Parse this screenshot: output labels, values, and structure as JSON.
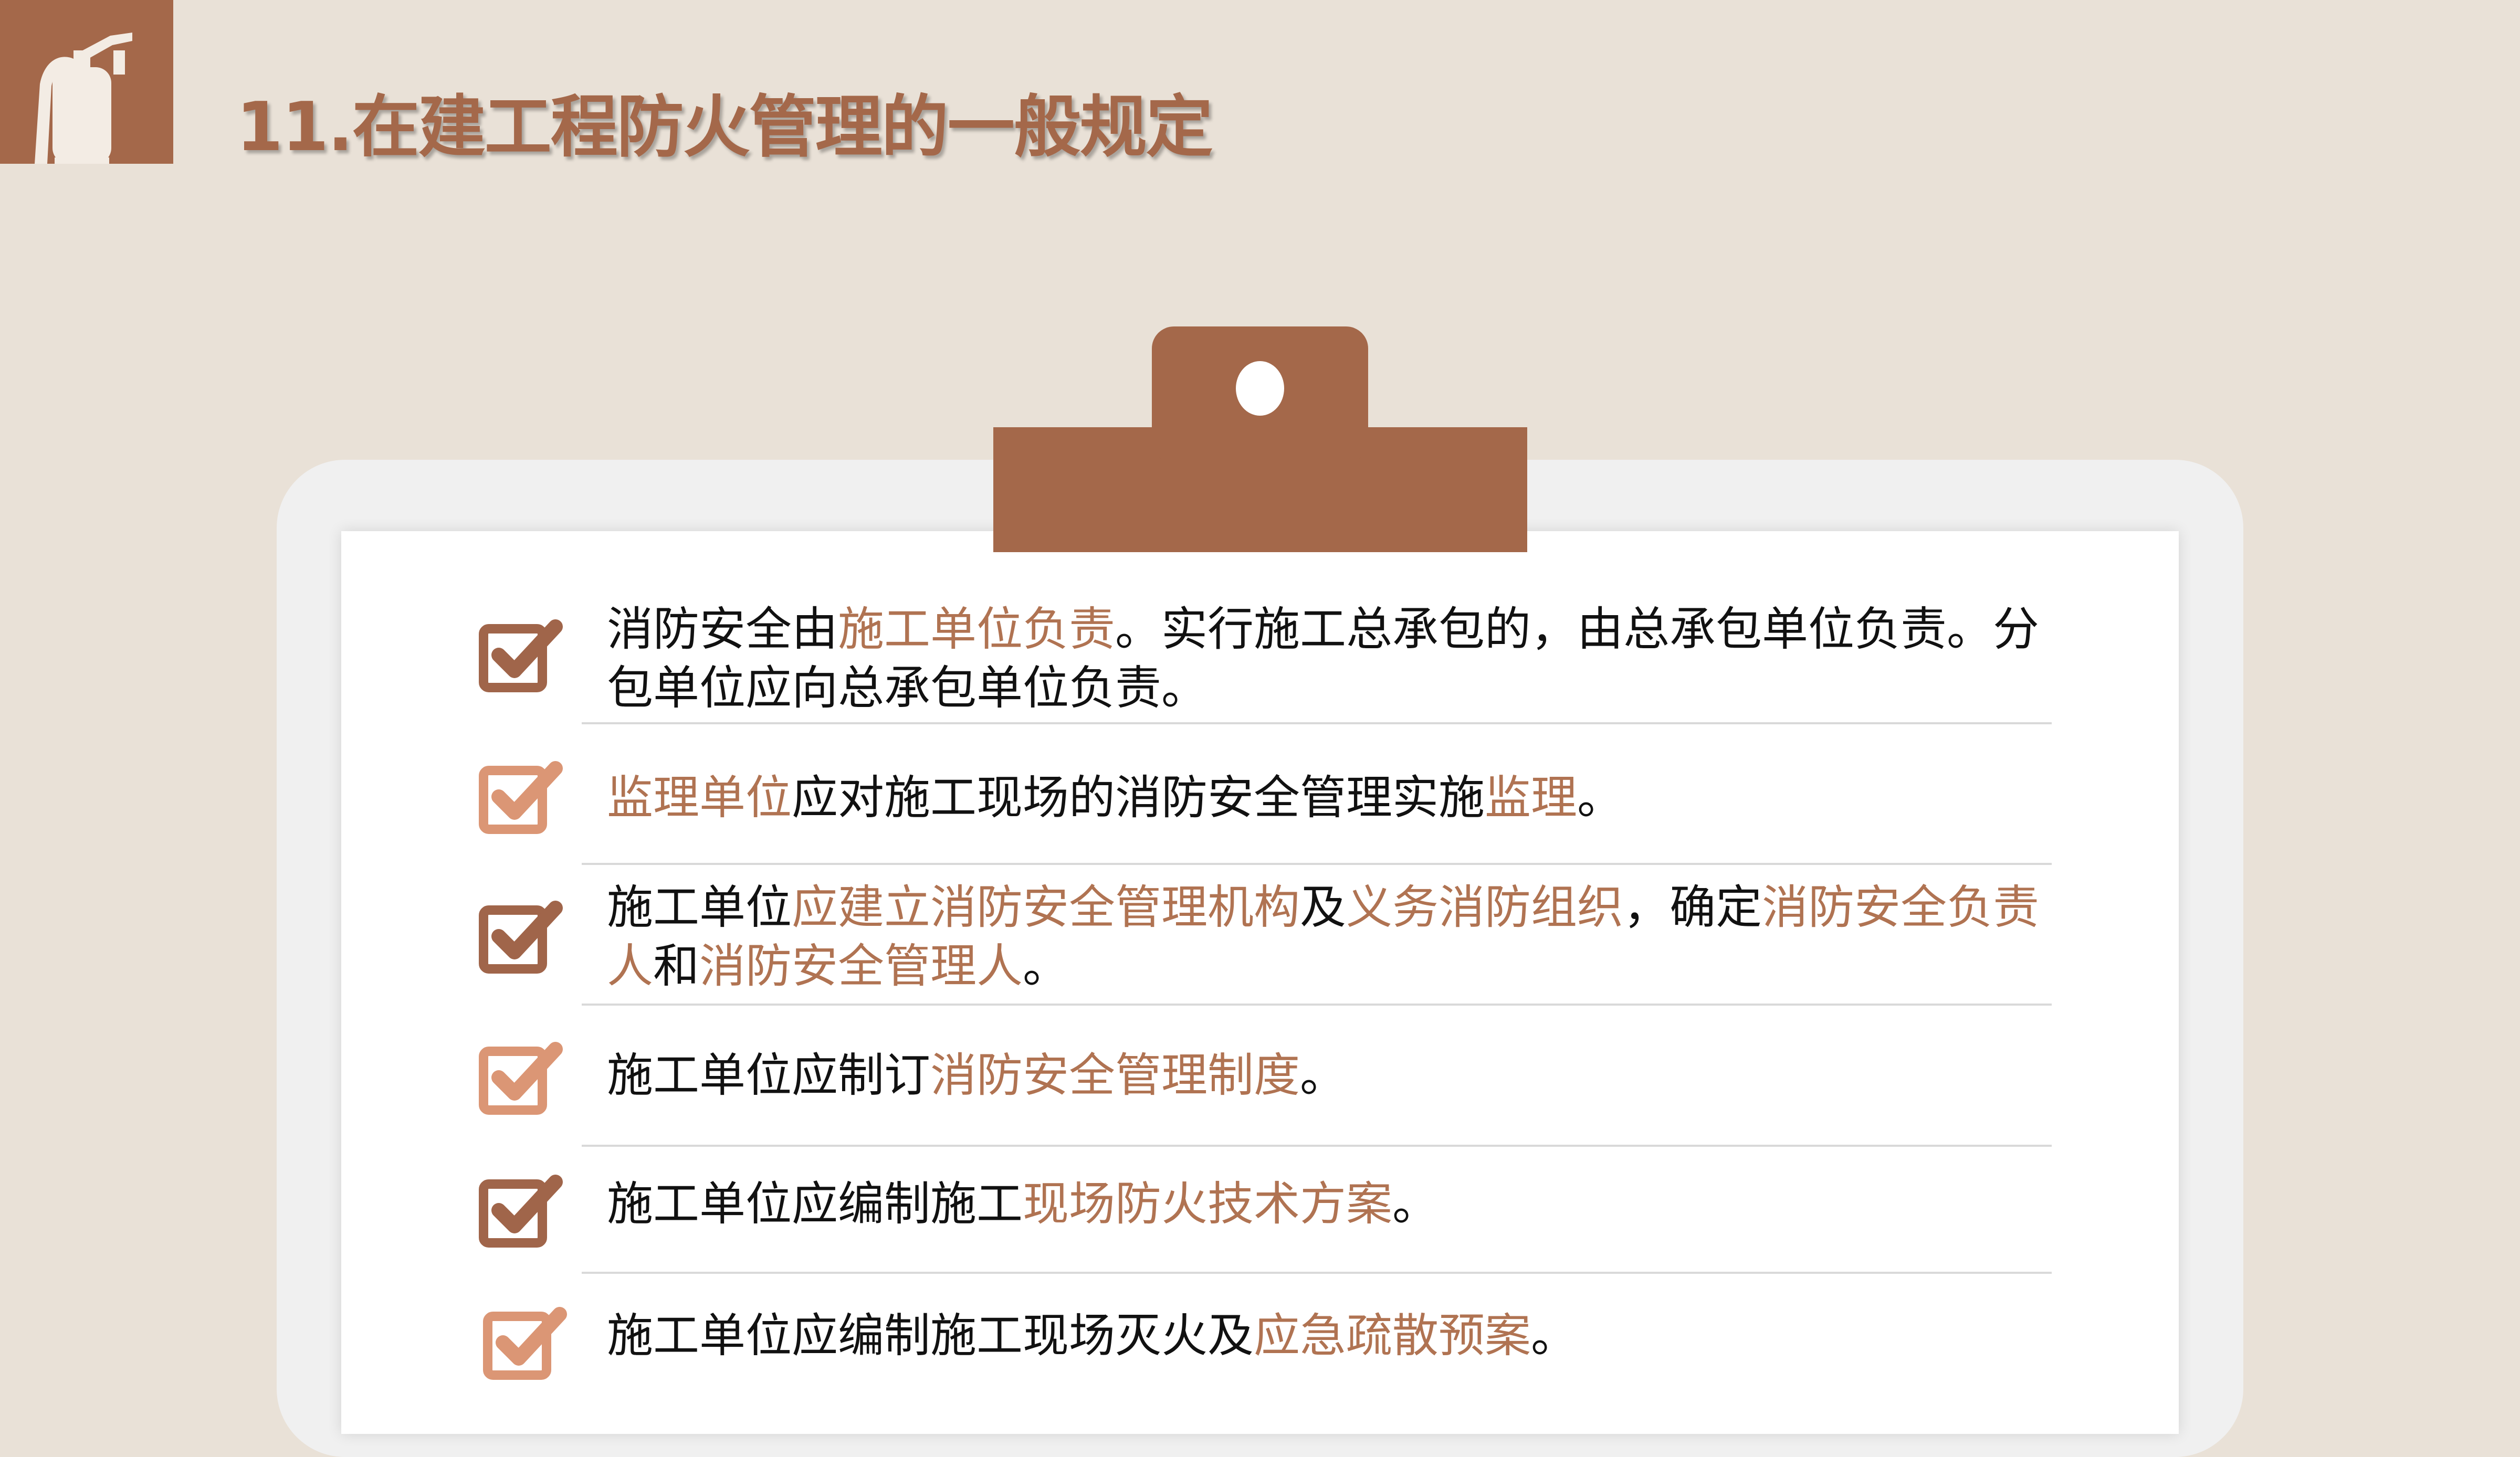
{
  "colors": {
    "background": "#e9e1d7",
    "brand": "#a4684a",
    "highlight": "#b07352",
    "check_dark": "#a0654a",
    "check_light": "#db9675",
    "text": "#111111"
  },
  "header": {
    "logo_icon": "fire-extinguisher-icon",
    "title": "11.在建工程防火管理的一般规定"
  },
  "checklist": {
    "items": [
      {
        "check_icon": "checkbox-checked-icon",
        "check_color": "dark",
        "segments": [
          {
            "t": "消防安全由",
            "hl": false
          },
          {
            "t": "施工单位负责",
            "hl": true
          },
          {
            "t": "。实行施工总承包的，由总承包单位负责。分包单位应向总承包单位负责。",
            "hl": false
          }
        ]
      },
      {
        "check_icon": "checkbox-checked-icon",
        "check_color": "light",
        "segments": [
          {
            "t": "监理单位",
            "hl": true
          },
          {
            "t": "应对施工现场的消防安全管理实施",
            "hl": false
          },
          {
            "t": "监理",
            "hl": true
          },
          {
            "t": "。",
            "hl": false
          }
        ]
      },
      {
        "check_icon": "checkbox-checked-icon",
        "check_color": "dark",
        "segments": [
          {
            "t": "施工单位",
            "hl": false
          },
          {
            "t": "应建立消防安全管理机构",
            "hl": true
          },
          {
            "t": "及",
            "hl": false
          },
          {
            "t": "义务消防组织",
            "hl": true
          },
          {
            "t": "，确定",
            "hl": false
          },
          {
            "t": "消防安全负责人",
            "hl": true
          },
          {
            "t": "和",
            "hl": false
          },
          {
            "t": "消防安全管理人",
            "hl": true
          },
          {
            "t": "。",
            "hl": false
          }
        ]
      },
      {
        "check_icon": "checkbox-checked-icon",
        "check_color": "light",
        "segments": [
          {
            "t": "施工单位应制订",
            "hl": false
          },
          {
            "t": "消防安全管理制度",
            "hl": true
          },
          {
            "t": "。",
            "hl": false
          }
        ]
      },
      {
        "check_icon": "checkbox-checked-icon",
        "check_color": "dark",
        "segments": [
          {
            "t": "施工单位应编制施工",
            "hl": false
          },
          {
            "t": "现场防火技术方案",
            "hl": true
          },
          {
            "t": "。",
            "hl": false
          }
        ]
      },
      {
        "check_icon": "checkbox-checked-icon",
        "check_color": "light",
        "segments": [
          {
            "t": "施工单位应编制施工现场灭火及",
            "hl": false
          },
          {
            "t": "应急疏散预案",
            "hl": true
          },
          {
            "t": "。",
            "hl": false
          }
        ]
      }
    ]
  }
}
